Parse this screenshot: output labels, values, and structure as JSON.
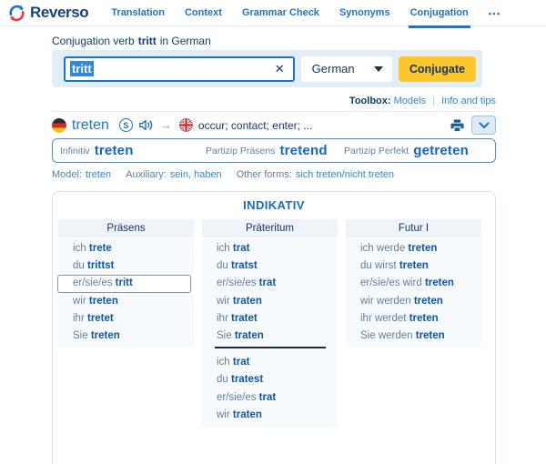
{
  "colors": {
    "accent": "#2273c4",
    "navy": "#0d3e70",
    "link": "#2e89d0",
    "verb": "#0e57a0",
    "pronoun": "#5f7f9e",
    "yellow": "#fcc62d",
    "panel": "#e3edf6",
    "colbg": "#f7fafc",
    "colhead": "#edf3f8",
    "pborder": "#4a8fd3",
    "boxborder": "#d5e1eb",
    "selbg": "#3087e0"
  },
  "nav": {
    "brand": "Reverso",
    "items": [
      {
        "label": "Translation",
        "active": false
      },
      {
        "label": "Context",
        "active": false
      },
      {
        "label": "Grammar Check",
        "active": false
      },
      {
        "label": "Synonyms",
        "active": false
      },
      {
        "label": "Conjugation",
        "active": true
      },
      {
        "label": "•••",
        "active": false
      }
    ]
  },
  "page_header": {
    "prefix": "Conjugation verb",
    "verb": "tritt",
    "suffix": "in German"
  },
  "search": {
    "value": "tritt",
    "clear_icon": "✕",
    "language": "German",
    "button": "Conjugate"
  },
  "toolbox": {
    "label": "Toolbox:",
    "models": "Models",
    "separator": "|",
    "info": "Info and tips"
  },
  "verb_header": {
    "verb": "treten",
    "synonyms_badge": "S",
    "arrow_icon": "→",
    "translation": "occur; contact; enter; ..."
  },
  "participles": [
    {
      "label": "Infinitiv",
      "value": "treten"
    },
    {
      "label": "Partizip Präsens",
      "value": "tretend"
    },
    {
      "label": "Partizip Perfekt",
      "value": "getreten"
    }
  ],
  "verb_info": {
    "model_label": "Model:",
    "model": "treten",
    "auxiliary_label": "Auxiliary:",
    "auxiliary": "sein, haben",
    "other_forms_label": "Other forms:",
    "other_forms": "sich treten/nicht treten"
  },
  "conjugation": {
    "mood": "INDIKATIV",
    "columns": [
      {
        "tense": "Präsens",
        "blocks": [
          [
            {
              "pre": "ich",
              "verb": "trete"
            },
            {
              "pre": "du",
              "verb": "trittst"
            },
            {
              "pre": "er/sie/es",
              "verb": "tritt",
              "highlighted": true
            },
            {
              "pre": "wir",
              "verb": "treten"
            },
            {
              "pre": "ihr",
              "verb": "tretet"
            },
            {
              "pre": "Sie",
              "verb": "treten"
            }
          ]
        ]
      },
      {
        "tense": "Präteritum",
        "blocks": [
          [
            {
              "pre": "ich",
              "verb": "trat"
            },
            {
              "pre": "du",
              "verb": "tratst"
            },
            {
              "pre": "er/sie/es",
              "verb": "trat"
            },
            {
              "pre": "wir",
              "verb": "traten"
            },
            {
              "pre": "ihr",
              "verb": "tratet"
            },
            {
              "pre": "Sie",
              "verb": "traten"
            }
          ],
          [
            {
              "pre": "ich",
              "verb": "trat"
            },
            {
              "pre": "du",
              "verb": "tratest"
            },
            {
              "pre": "er/sie/es",
              "verb": "trat"
            },
            {
              "pre": "wir",
              "verb": "traten"
            }
          ]
        ]
      },
      {
        "tense": "Futur I",
        "blocks": [
          [
            {
              "pre": "ich werde",
              "verb": "treten"
            },
            {
              "pre": "du wirst",
              "verb": "treten"
            },
            {
              "pre": "er/sie/es wird",
              "verb": "treten"
            },
            {
              "pre": "wir werden",
              "verb": "treten"
            },
            {
              "pre": "ihr werdet",
              "verb": "treten"
            },
            {
              "pre": "Sie werden",
              "verb": "treten"
            }
          ]
        ]
      }
    ]
  }
}
